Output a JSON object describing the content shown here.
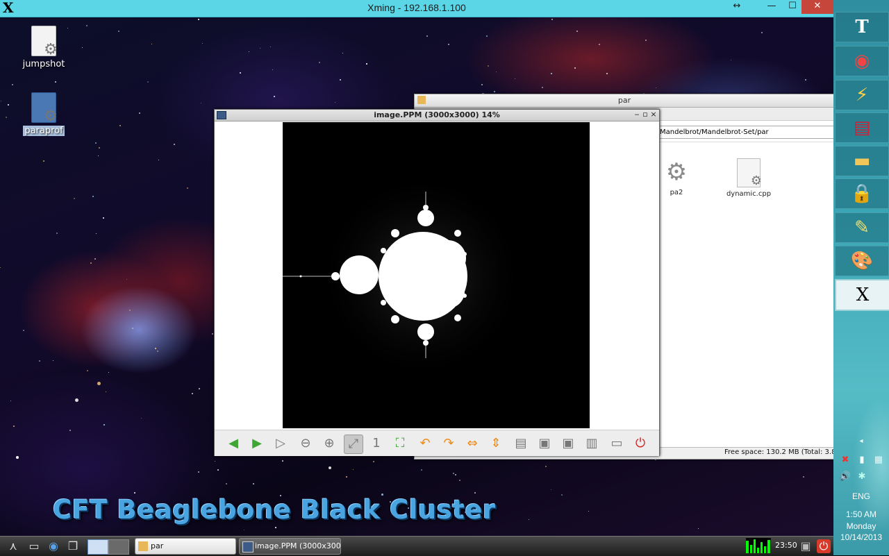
{
  "xming": {
    "title": "Xming - 192.168.1.100",
    "resize_glyph": "↔",
    "minimize_glyph": "—",
    "maximize_glyph": "☐",
    "close_glyph": "✕"
  },
  "desktop": {
    "icons": [
      {
        "label": "jumpshot"
      },
      {
        "label": "paraprof"
      }
    ],
    "banner": "CFT Beaglebone Black Cluster"
  },
  "file_manager": {
    "title": "par",
    "path": "Mandelbrot/Mandelbrot-Set/par",
    "files": [
      {
        "name": "pa2",
        "icon": "gear-icon"
      },
      {
        "name": "dynamic.cpp",
        "icon": "cpp-file-icon"
      }
    ],
    "status": "Free space: 130.2 MB (Total: 3.8"
  },
  "image_viewer": {
    "title": "image.PPM (3000x3000) 14%",
    "toolbar": [
      {
        "name": "previous-button",
        "glyph": "◀"
      },
      {
        "name": "next-button",
        "glyph": "▶"
      },
      {
        "name": "slideshow-button",
        "glyph": "▷"
      },
      {
        "name": "zoom-out-button",
        "glyph": "⊖"
      },
      {
        "name": "zoom-in-button",
        "glyph": "⊕"
      },
      {
        "name": "zoom-fit-button",
        "glyph": "⤢"
      },
      {
        "name": "zoom-original-button",
        "glyph": "1"
      },
      {
        "name": "fullscreen-button",
        "glyph": "⛶"
      },
      {
        "name": "rotate-left-button",
        "glyph": "↶"
      },
      {
        "name": "rotate-right-button",
        "glyph": "↷"
      },
      {
        "name": "flip-horizontal-button",
        "glyph": "⇔"
      },
      {
        "name": "flip-vertical-button",
        "glyph": "⇕"
      },
      {
        "name": "open-file-button",
        "glyph": "▤"
      },
      {
        "name": "save-button",
        "glyph": "▣"
      },
      {
        "name": "save-as-button",
        "glyph": "▣"
      },
      {
        "name": "delete-button",
        "glyph": "▥"
      },
      {
        "name": "preferences-button",
        "glyph": "▭"
      },
      {
        "name": "quit-button",
        "glyph": "⏻"
      }
    ]
  },
  "taskbar": {
    "tasks": [
      {
        "label": "par"
      },
      {
        "label": "image.PPM (3000x300..."
      }
    ],
    "clock": "23:50"
  },
  "windows_bar": {
    "language": "ENG",
    "time": "1:50 AM",
    "day": "Monday",
    "date": "10/14/2013"
  }
}
